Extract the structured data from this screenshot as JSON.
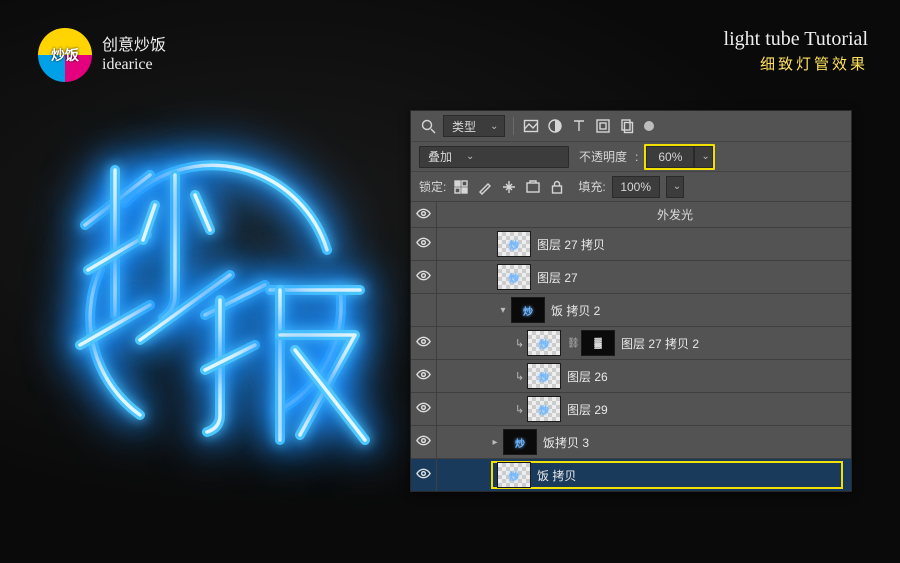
{
  "brand": {
    "cn": "创意炒饭",
    "en": "idearice"
  },
  "tutorial": {
    "en": "light tube Tutorial",
    "cn": "细致灯管效果"
  },
  "artwork": {
    "neon_text": "炒饭",
    "accent_color": "#4fc7ff"
  },
  "panel": {
    "filter_label": "类型",
    "blend_mode": "叠加",
    "opacity_label": "不透明度",
    "opacity_value": "60%",
    "lock_label": "锁定:",
    "fill_label": "填充:",
    "fill_value": "100%",
    "fx_sublabel": "外发光",
    "filter_icons": [
      "image-icon",
      "adjustment-icon",
      "type-icon",
      "shape-icon",
      "smartobj-icon"
    ]
  },
  "layers": [
    {
      "id": "l1",
      "visible": true,
      "depth": 2,
      "twisty": "",
      "clip": "",
      "thumbs": [
        "xp"
      ],
      "name": "图层 27 拷贝",
      "selected": false
    },
    {
      "id": "l2",
      "visible": true,
      "depth": 2,
      "twisty": "",
      "clip": "",
      "thumbs": [
        "xp"
      ],
      "name": "图层 27",
      "selected": false
    },
    {
      "id": "l3",
      "visible": false,
      "depth": 2,
      "twisty": "▾",
      "clip": "",
      "thumbs": [
        "xp-dark"
      ],
      "name": "饭 拷贝 2",
      "selected": false
    },
    {
      "id": "l4",
      "visible": true,
      "depth": 3,
      "twisty": "",
      "clip": "↳",
      "thumbs": [
        "xp",
        "mask"
      ],
      "link": true,
      "name": "图层 27 拷贝 2",
      "selected": false
    },
    {
      "id": "l5",
      "visible": true,
      "depth": 3,
      "twisty": "",
      "clip": "↳",
      "thumbs": [
        "xp"
      ],
      "name": "图层 26",
      "selected": false
    },
    {
      "id": "l6",
      "visible": true,
      "depth": 3,
      "twisty": "",
      "clip": "↳",
      "thumbs": [
        "xp"
      ],
      "name": "图层 29",
      "selected": false
    },
    {
      "id": "l7",
      "visible": true,
      "depth": 4,
      "twisty": "▸",
      "clip": "",
      "thumbs": [
        "xp-dark"
      ],
      "name": "饭拷贝 3",
      "selected": false
    },
    {
      "id": "l8",
      "visible": true,
      "depth": 5,
      "twisty": "",
      "clip": "",
      "thumbs": [
        "xp"
      ],
      "name": "饭 拷贝",
      "selected": true,
      "highlight": true
    }
  ]
}
